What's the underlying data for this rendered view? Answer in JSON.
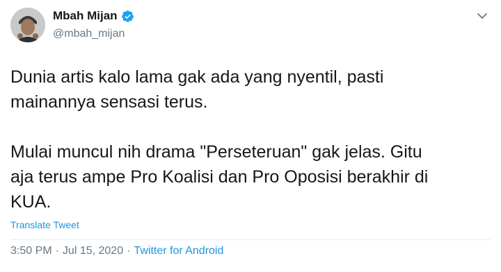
{
  "author": {
    "display_name": "Mbah Mijan",
    "handle": "@mbah_mijan",
    "verified": true,
    "avatar_icon": "profile-photo"
  },
  "tweet": {
    "text": "Dunia artis kalo lama gak ada yang nyentil, pasti\nmainannya sensasi terus.\n\nMulai muncul nih drama \"Perseteruan\" gak jelas. Gitu\naja terus ampe Pro Koalisi dan Pro Oposisi berakhir di\nKUA.",
    "translate_label": "Translate Tweet"
  },
  "meta": {
    "time": "3:50 PM",
    "separator": "·",
    "date": "Jul 15, 2020",
    "source": "Twitter for Android"
  },
  "colors": {
    "accent": "#1b95e0",
    "secondary_text": "#657786",
    "verified_badge": "#1da1f2"
  }
}
